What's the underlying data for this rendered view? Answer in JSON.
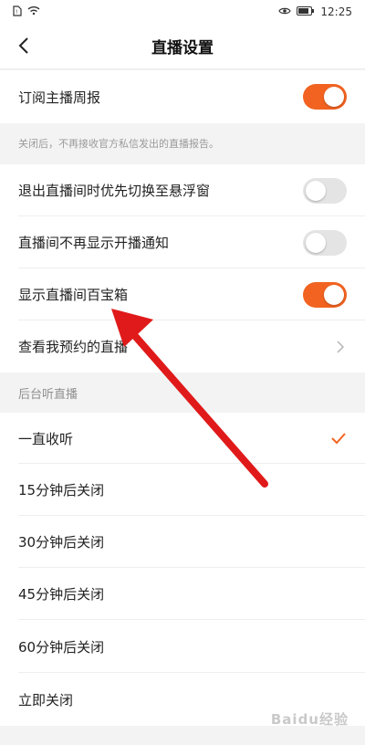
{
  "status_bar": {
    "time": "12:25"
  },
  "nav": {
    "title": "直播设置"
  },
  "settings": {
    "subscribe_weekly": {
      "label": "订阅主播周报",
      "on": true
    },
    "subscribe_note": "关闭后，不再接收官方私信发出的直播报告。",
    "float_window": {
      "label": "退出直播间时优先切换至悬浮窗",
      "on": false
    },
    "no_start_notice": {
      "label": "直播间不再显示开播通知",
      "on": false
    },
    "treasure_box": {
      "label": "显示直播间百宝箱",
      "on": true
    },
    "my_bookings": {
      "label": "查看我预约的直播"
    }
  },
  "background_listening": {
    "header": "后台听直播",
    "options": [
      {
        "label": "一直收听",
        "selected": true
      },
      {
        "label": "15分钟后关闭",
        "selected": false
      },
      {
        "label": "30分钟后关闭",
        "selected": false
      },
      {
        "label": "45分钟后关闭",
        "selected": false
      },
      {
        "label": "60分钟后关闭",
        "selected": false
      },
      {
        "label": "立即关闭",
        "selected": false
      }
    ]
  },
  "colors": {
    "accent": "#f26321",
    "annotation_arrow": "#e01a1a"
  },
  "watermark": {
    "text": "Baidu经验"
  }
}
